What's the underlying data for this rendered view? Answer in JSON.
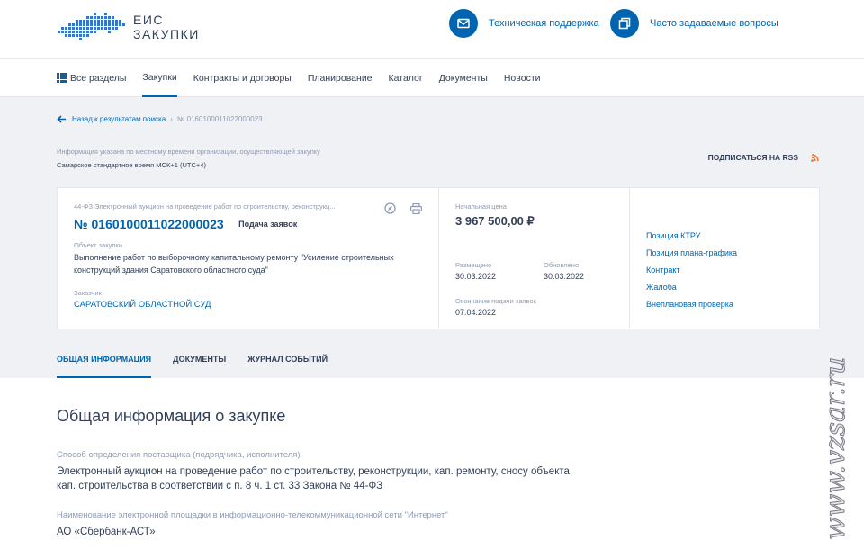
{
  "header": {
    "logo_line1": "ЕИС",
    "logo_line2": "ЗАКУПКИ",
    "support_label": "Техническая поддержка",
    "faq_label": "Часто задаваемые вопросы",
    "accent": "#0065b1"
  },
  "nav": {
    "items": [
      "Все разделы",
      "Закупки",
      "Контракты и договоры",
      "Планирование",
      "Каталог",
      "Документы",
      "Новости"
    ],
    "active": "Закупки"
  },
  "breadcrumb": {
    "back_label": "Назад к результатам поиска",
    "separator": "›",
    "current": "№ 0160100011022000023"
  },
  "timezone": {
    "note": "Информация указана по местному времени организации, осуществляющей закупку",
    "value": "Самарское стандартное время МСК+1 (UTC+4)"
  },
  "rss_label": "ПОДПИСАТЬСЯ НА RSS",
  "card": {
    "procurement_type": "44-ФЗ Электронный аукцион на проведение работ по строительству, реконструкц...",
    "number": "№ 0160100011022000023",
    "stage": "Подача заявок",
    "object_label": "Объект закупки",
    "object_text": "Выполнение работ по выборочному капитальному ремонту \"Усиление строительных конструкций здания Саратовского областного суда\"",
    "customer_label": "Заказчик",
    "customer": "САРАТОВСКИЙ ОБЛАСТНОЙ СУД",
    "price_label": "Начальная цена",
    "price": "3 967 500,00 ₽",
    "posted_label": "Размещено",
    "posted": "30.03.2022",
    "updated_label": "Обновлено",
    "updated": "30.03.2022",
    "deadline_label": "Окончание подачи заявок",
    "deadline": "07.04.2022",
    "links": [
      "Позиция КТРУ",
      "Позиция плана-графика",
      "Контракт",
      "Жалоба",
      "Внеплановая проверка"
    ]
  },
  "tabs": [
    "ОБЩАЯ ИНФОРМАЦИЯ",
    "ДОКУМЕНТЫ",
    "ЖУРНАЛ СОБЫТИЙ"
  ],
  "main": {
    "title": "Общая информация о закупке",
    "method_label": "Способ определения поставщика (подрядчика, исполнителя)",
    "method_value": "Электронный аукцион на проведение работ по строительству, реконструкции, кап. ремонту, сносу объекта кап. строительства в соответствии с п. 8 ч. 1 ст. 33 Закона № 44-ФЗ",
    "platform_label": "Наименование электронной площадки в информационно-телекоммуникационной сети \"Интернет\"",
    "platform_value": "АО «Сбербанк-АСТ»"
  },
  "watermark": "www.vzsar.ru"
}
